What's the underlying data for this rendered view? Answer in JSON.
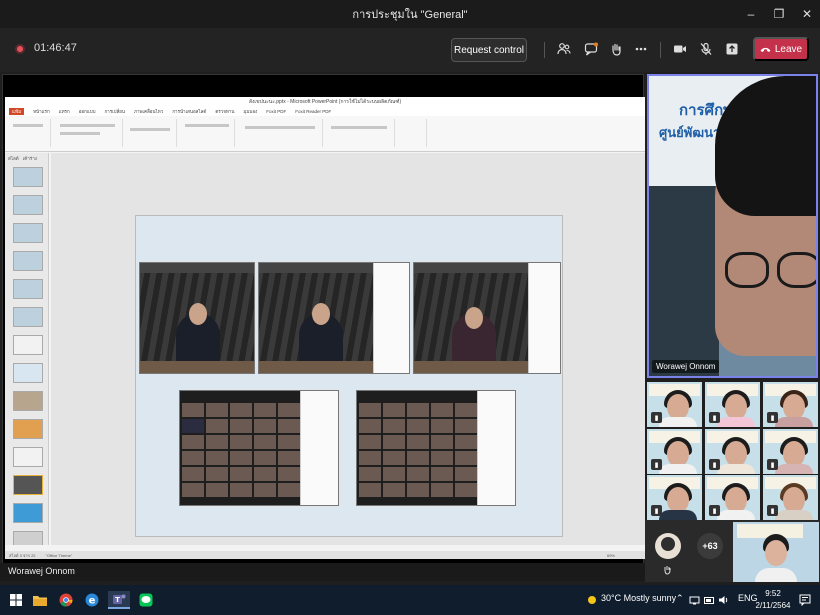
{
  "window": {
    "title": "การประชุมใน \"General\"",
    "controls": [
      "–",
      "❐",
      "✕"
    ]
  },
  "toolbar": {
    "timer": "01:46:47",
    "request_control_label": "Request control",
    "leave_label": "Leave",
    "icons": [
      "people-icon",
      "chat-icon",
      "raise-hand-icon",
      "more-icon",
      "camera-icon",
      "mic-off-icon",
      "share-icon"
    ],
    "leave_color": "#c4314b"
  },
  "shared_screen": {
    "presenter_name": "Worawej Onnom",
    "ppt": {
      "file_title": "สังเขปนะนะ.pptx - Microsoft PowerPoint (การใช้ไม่ได้ระบบผลิตภัณฑ์)",
      "tabs": [
        "แฟ้ม",
        "หน้าแรก",
        "แทรก",
        "ออกแบบ",
        "การเปลี่ยน",
        "ภาพเคลื่อนไหว",
        "การนำเสนอสไลด์",
        "ตรวจทาน",
        "มุมมอง",
        "Foxit PDF",
        "Foxit Reader PDF"
      ],
      "thumb_tabs": [
        "สไลด์",
        "เค้าร่าง"
      ],
      "status_text": "สไลด์ 3 จาก 22",
      "theme_text": "\"Office Theme\"",
      "zoom": "69%"
    }
  },
  "speaker": {
    "name": "Worawej Onnom",
    "sign_line1": "การศึกษาดู",
    "sign_line2": "ศูนย์พัฒนาทุนมนุ"
  },
  "participants": {
    "more_count": "+63"
  },
  "taskbar": {
    "weather": "30°C  Mostly sunny",
    "language": "ENG",
    "time": "9:52",
    "date": "2/11/2564"
  }
}
